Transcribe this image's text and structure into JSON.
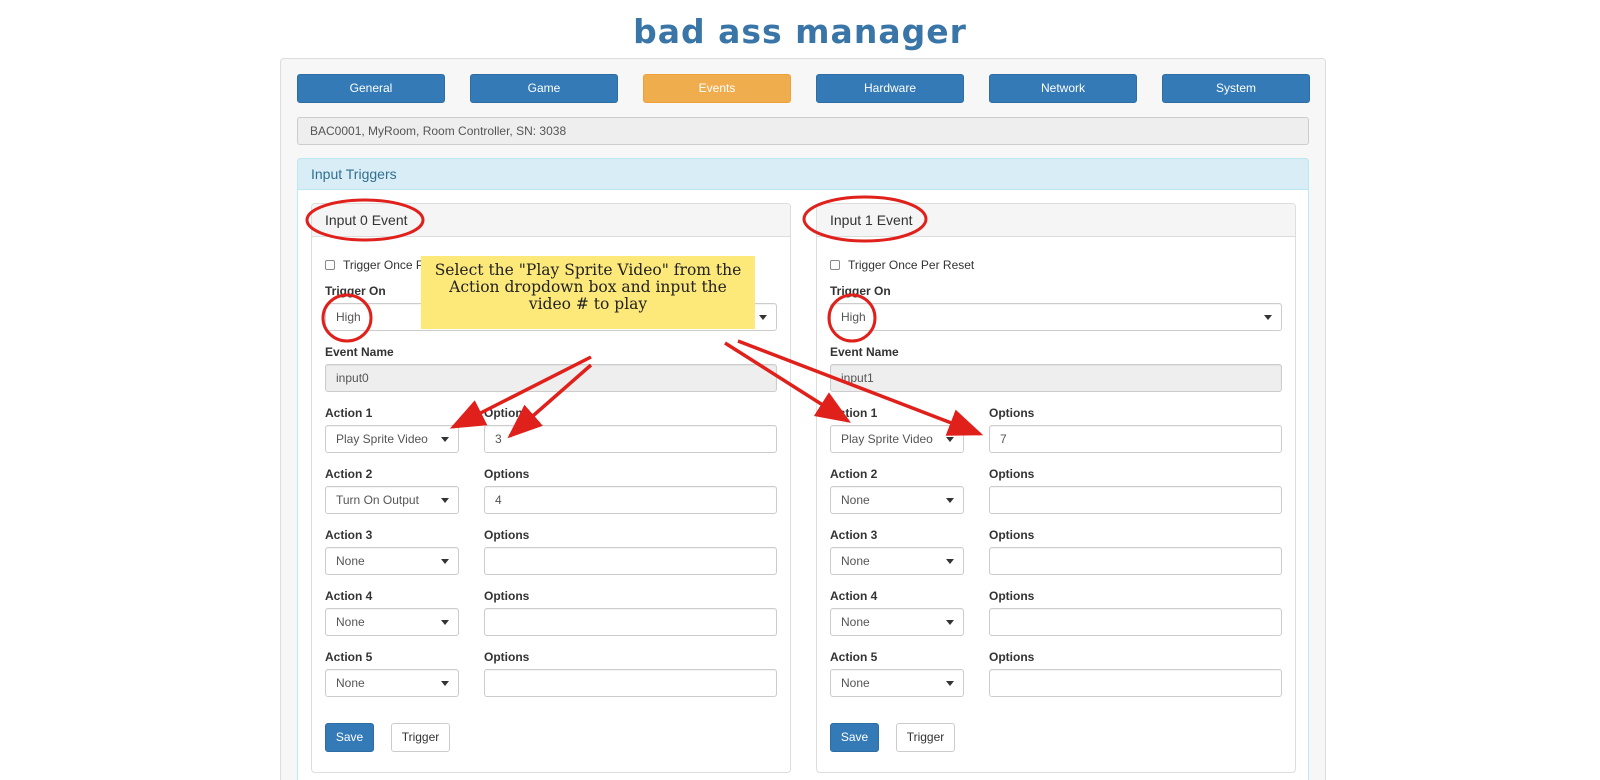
{
  "app": {
    "title": "bad ass manager"
  },
  "nav": [
    {
      "label": "General",
      "active": false
    },
    {
      "label": "Game",
      "active": false
    },
    {
      "label": "Events",
      "active": true
    },
    {
      "label": "Hardware",
      "active": false
    },
    {
      "label": "Network",
      "active": false
    },
    {
      "label": "System",
      "active": false
    }
  ],
  "device_info": "BAC0001, MyRoom, Room Controller, SN: 3038",
  "section": {
    "title": "Input Triggers"
  },
  "panels": [
    {
      "title": "Input 0 Event",
      "trigger_once_label": "Trigger Once Per Reset",
      "trigger_once_visible": "Trigger Once Pe",
      "trigger_on_label": "Trigger On",
      "trigger_on_value": "High",
      "event_name_label": "Event Name",
      "event_name_value": "input0",
      "actions": [
        {
          "label": "Action 1",
          "value": "Play Sprite Video",
          "options_label": "Options",
          "options_value": "3"
        },
        {
          "label": "Action 2",
          "value": "Turn On Output",
          "options_label": "Options",
          "options_value": "4"
        },
        {
          "label": "Action 3",
          "value": "None",
          "options_label": "Options",
          "options_value": ""
        },
        {
          "label": "Action 4",
          "value": "None",
          "options_label": "Options",
          "options_value": ""
        },
        {
          "label": "Action 5",
          "value": "None",
          "options_label": "Options",
          "options_value": ""
        }
      ],
      "save_label": "Save",
      "trigger_label": "Trigger"
    },
    {
      "title": "Input 1 Event",
      "trigger_once_label": "Trigger Once Per Reset",
      "trigger_once_visible": "Trigger Once Per Reset",
      "trigger_on_label": "Trigger On",
      "trigger_on_value": "High",
      "event_name_label": "Event Name",
      "event_name_value": "input1",
      "actions": [
        {
          "label": "Action 1",
          "value": "Play Sprite Video",
          "options_label": "Options",
          "options_value": "7"
        },
        {
          "label": "Action 2",
          "value": "None",
          "options_label": "Options",
          "options_value": ""
        },
        {
          "label": "Action 3",
          "value": "None",
          "options_label": "Options",
          "options_value": ""
        },
        {
          "label": "Action 4",
          "value": "None",
          "options_label": "Options",
          "options_value": ""
        },
        {
          "label": "Action 5",
          "value": "None",
          "options_label": "Options",
          "options_value": ""
        }
      ],
      "save_label": "Save",
      "trigger_label": "Trigger"
    }
  ],
  "annotation": {
    "text": "Select the \"Play Sprite Video\" from the Action dropdown box and input the video # to play",
    "line1": "Select the \"Play Sprite Video\" from the",
    "line2": "Action dropdown box and input the",
    "line3": "video # to play",
    "color": "#e0201b",
    "note_color": "#fde97a"
  },
  "colors": {
    "primary": "#337ab7",
    "active": "#f0ad4e",
    "info_bg": "#d9edf7",
    "info_text": "#31708f"
  }
}
